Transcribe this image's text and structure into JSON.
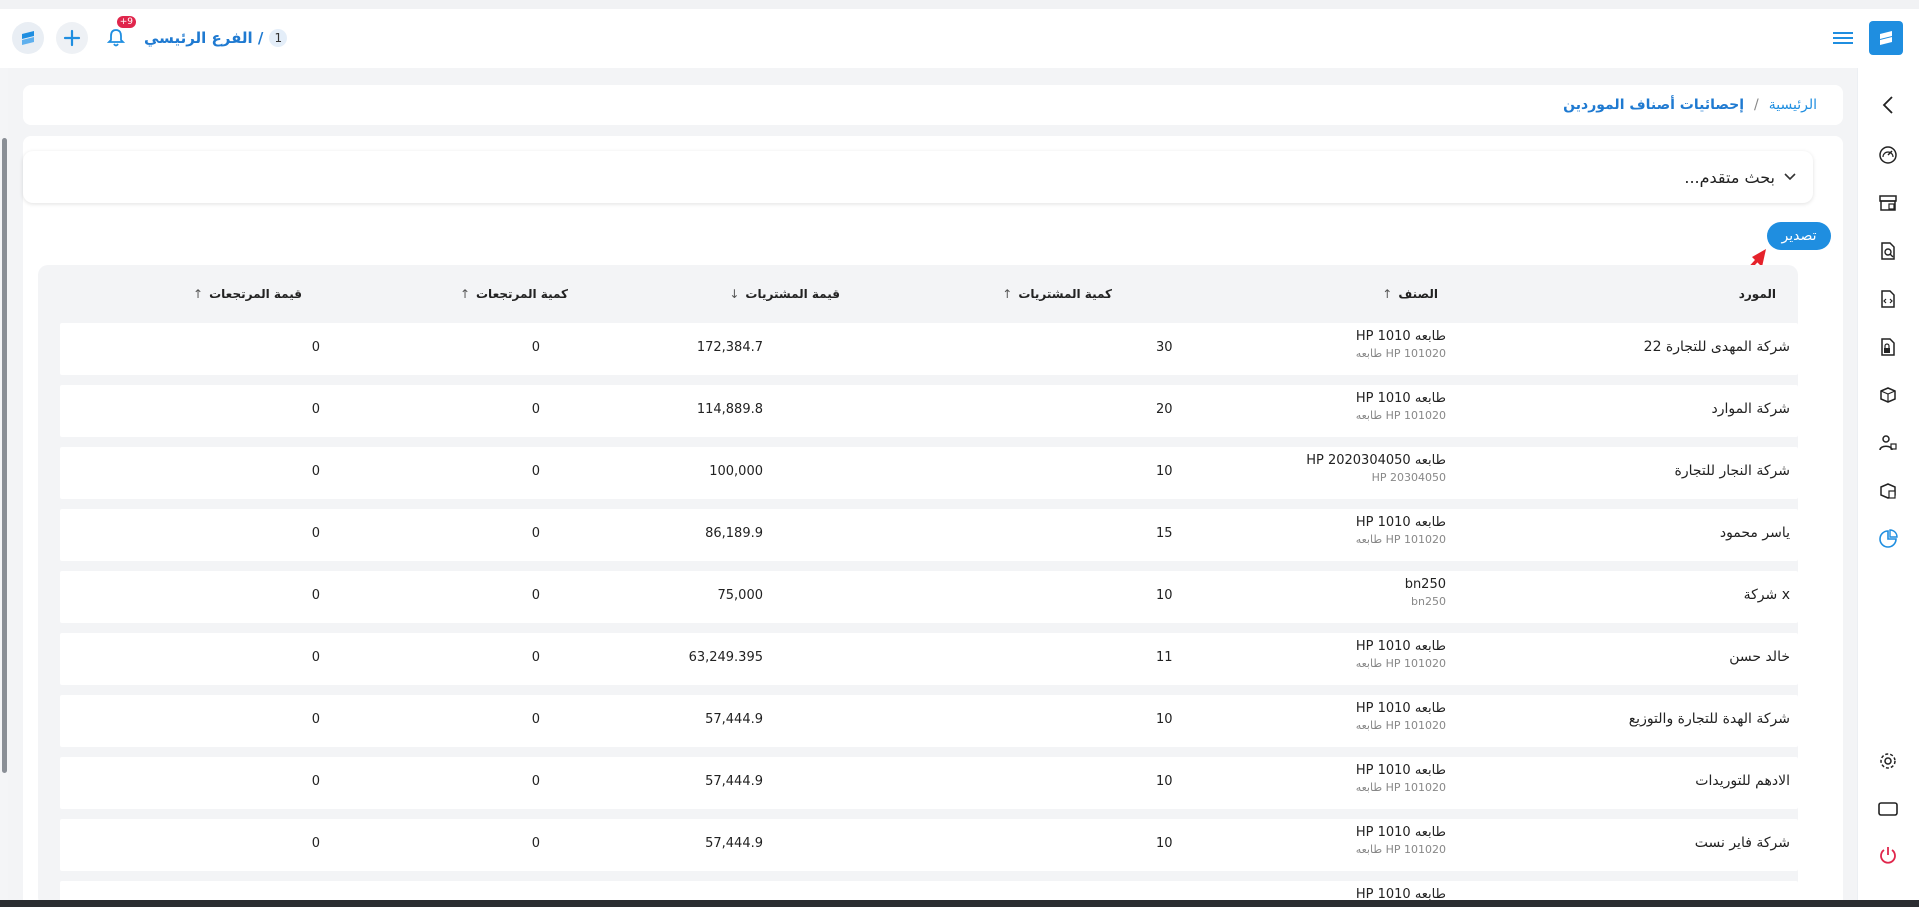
{
  "topbar": {
    "branch_name": "الفرع الرئيسي /",
    "branch_number": "1",
    "notification_count": "+9"
  },
  "breadcrumb": {
    "home": "الرئيسية",
    "separator": "/",
    "current": "إحصائيات أصناف الموردين"
  },
  "search": {
    "advanced_label": "بحث متقدم..."
  },
  "toolbar": {
    "export_label": "تصدير"
  },
  "table": {
    "headers": {
      "supplier": "المورد",
      "item": "الصنف",
      "purchase_qty": "كمية المشتريات",
      "purchase_value": "قيمة المشتريات",
      "return_qty": "كمية المرتجعات",
      "return_value": "قيمة المرتجعات"
    },
    "sort_icons": {
      "item": "↑",
      "purchase_qty": "↑",
      "purchase_value": "↓",
      "return_qty": "↑",
      "return_value": "↑"
    },
    "rows": [
      {
        "supplier": "شركة المهدى للتجارة 22",
        "item_name": "طابعه HP 1010",
        "item_code": "HP 101020 طابعه",
        "purchase_qty": "30",
        "purchase_value": "172,384.7",
        "return_qty": "0",
        "return_value": "0"
      },
      {
        "supplier": "شركة الموارد",
        "item_name": "طابعه HP 1010",
        "item_code": "HP 101020 طابعه",
        "purchase_qty": "20",
        "purchase_value": "114,889.8",
        "return_qty": "0",
        "return_value": "0"
      },
      {
        "supplier": "شركة النجار للتجارة",
        "item_name": "طابعه HP 2020304050",
        "item_code": "HP 20304050",
        "purchase_qty": "10",
        "purchase_value": "100,000",
        "return_qty": "0",
        "return_value": "0"
      },
      {
        "supplier": "ياسر محمود",
        "item_name": "طابعه HP 1010",
        "item_code": "HP 101020 طابعه",
        "purchase_qty": "15",
        "purchase_value": "86,189.9",
        "return_qty": "0",
        "return_value": "0"
      },
      {
        "supplier": "شركة x",
        "item_name": "bn250",
        "item_code": "bn250",
        "purchase_qty": "10",
        "purchase_value": "75,000",
        "return_qty": "0",
        "return_value": "0"
      },
      {
        "supplier": "خالد حسن",
        "item_name": "طابعه HP 1010",
        "item_code": "HP 101020 طابعه",
        "purchase_qty": "11",
        "purchase_value": "63,249.395",
        "return_qty": "0",
        "return_value": "0"
      },
      {
        "supplier": "شركة الهدة للتجارة والتوزيع",
        "item_name": "طابعه HP 1010",
        "item_code": "HP 101020 طابعه",
        "purchase_qty": "10",
        "purchase_value": "57,444.9",
        "return_qty": "0",
        "return_value": "0"
      },
      {
        "supplier": "الادهم للتوريدات",
        "item_name": "طابعه HP 1010",
        "item_code": "HP 101020 طابعه",
        "purchase_qty": "10",
        "purchase_value": "57,444.9",
        "return_qty": "0",
        "return_value": "0"
      },
      {
        "supplier": "شركة فاير نست",
        "item_name": "طابعه HP 1010",
        "item_code": "HP 101020 طابعه",
        "purchase_qty": "10",
        "purchase_value": "57,444.9",
        "return_qty": "0",
        "return_value": "0"
      },
      {
        "supplier": "",
        "item_name": "طابعه HP 1010",
        "item_code": "",
        "purchase_qty": "",
        "purchase_value": "",
        "return_qty": "",
        "return_value": ""
      }
    ]
  },
  "sidebar": {
    "items": [
      {
        "icon": "chevron-left-icon"
      },
      {
        "icon": "dashboard-icon"
      },
      {
        "icon": "warehouse-icon"
      },
      {
        "icon": "search-document-icon"
      },
      {
        "icon": "invoice-icon"
      },
      {
        "icon": "document-lock-icon"
      },
      {
        "icon": "products-icon"
      },
      {
        "icon": "users-icon"
      },
      {
        "icon": "inventory-icon"
      },
      {
        "icon": "reports-chart-icon"
      },
      {
        "icon": "settings-icon"
      },
      {
        "icon": "screen-icon"
      },
      {
        "icon": "power-icon"
      }
    ]
  },
  "colors": {
    "primary": "#1f8ee0",
    "badge": "#e0264c",
    "annotation_arrow": "#e5222b",
    "power": "#e0264c"
  }
}
